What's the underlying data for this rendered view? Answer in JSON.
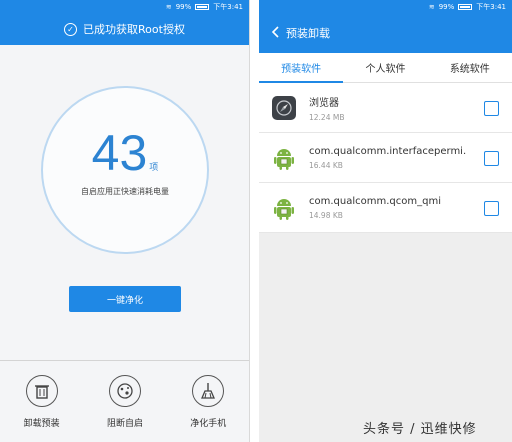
{
  "status_bar": {
    "battery": "99%",
    "time": "下午3:41"
  },
  "left": {
    "title": "已成功获取Root授权",
    "count": "43",
    "count_unit": "项",
    "subtitle": "自启应用正快速消耗电量",
    "action_button": "一键净化",
    "bottom_items": [
      {
        "label": "卸载预装",
        "icon": "trash-icon"
      },
      {
        "label": "阻断自启",
        "icon": "block-icon"
      },
      {
        "label": "净化手机",
        "icon": "broom-icon"
      }
    ]
  },
  "right": {
    "title": "预装卸载",
    "tabs": [
      "预装软件",
      "个人软件",
      "系统软件"
    ],
    "apps": [
      {
        "name": "浏览器",
        "size": "12.24 MB",
        "icon": "browser-icon"
      },
      {
        "name": "com.qualcomm.interfacepermi.",
        "size": "16.44 KB",
        "icon": "android-icon"
      },
      {
        "name": "com.qualcomm.qcom_qmi",
        "size": "14.98 KB",
        "icon": "android-icon"
      }
    ]
  },
  "watermark": "头条号 / 迅维快修",
  "colors": {
    "primary": "#1f88e5",
    "ring": "#bcd8f1",
    "text": "#333333"
  }
}
